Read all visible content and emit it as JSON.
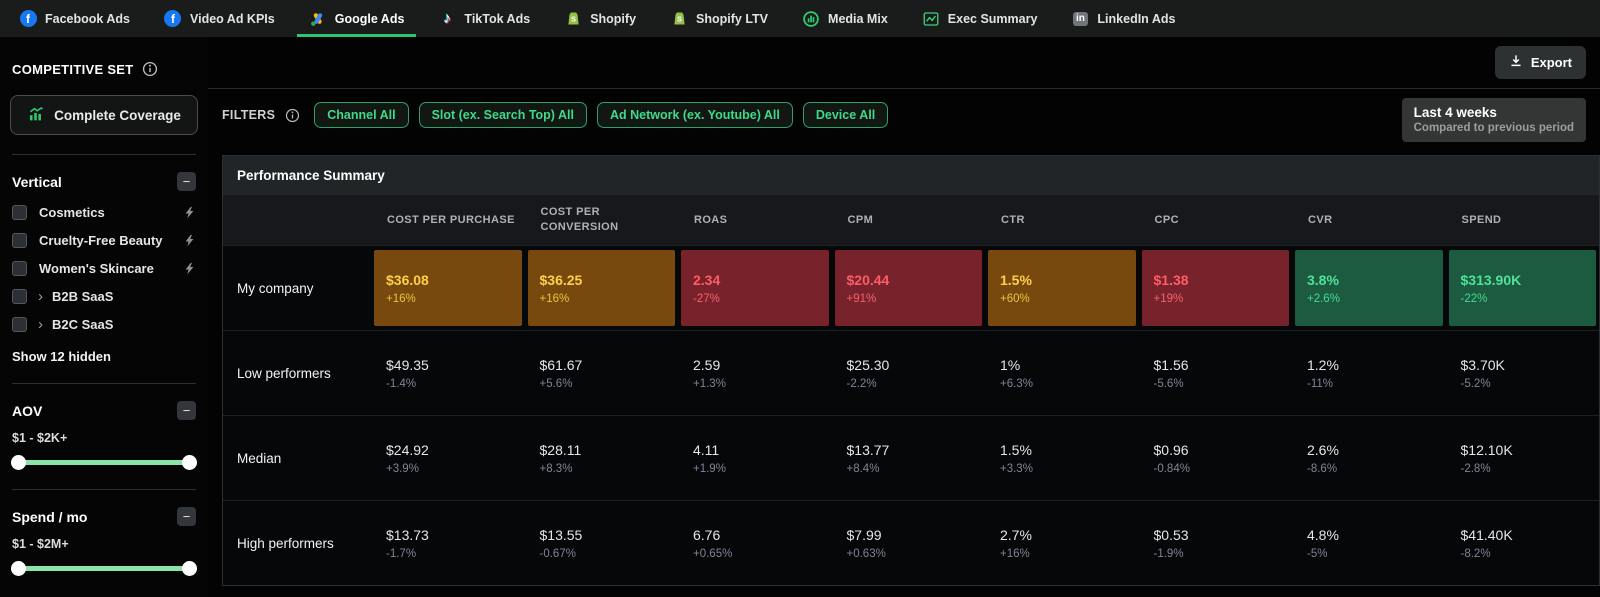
{
  "icons": {
    "facebook_f": "f",
    "music_note": "♪",
    "linkedin_in": "in",
    "chevron_right": "›",
    "minus": "−"
  },
  "colors": {
    "accent_green": "#2ec471",
    "chip_green": "#3fd98a",
    "slider_green": "#8ce3a7",
    "facebook_blue": "#1877f2",
    "warn_bg": "#77490f",
    "warn_text": "#ffd04a",
    "bad_bg": "#78232b",
    "bad_text": "#ff5c68",
    "good_bg": "#1d5b40",
    "good_text": "#4fe29a"
  },
  "nav": {
    "tabs": [
      {
        "label": "Facebook Ads",
        "icon": "facebook-icon",
        "active": false
      },
      {
        "label": "Video Ad KPIs",
        "icon": "facebook-icon",
        "active": false
      },
      {
        "label": "Google Ads",
        "icon": "google-ads-icon",
        "active": true
      },
      {
        "label": "TikTok Ads",
        "icon": "tiktok-icon",
        "active": false
      },
      {
        "label": "Shopify",
        "icon": "shopify-icon",
        "active": false
      },
      {
        "label": "Shopify LTV",
        "icon": "shopify-icon",
        "active": false
      },
      {
        "label": "Media Mix",
        "icon": "media-mix-icon",
        "active": false
      },
      {
        "label": "Exec Summary",
        "icon": "exec-summary-icon",
        "active": false
      },
      {
        "label": "LinkedIn Ads",
        "icon": "linkedin-icon",
        "active": false
      }
    ]
  },
  "sidebar": {
    "title": "COMPETITIVE SET",
    "coverage_button_label": "Complete Coverage",
    "vertical": {
      "title": "Vertical",
      "items": [
        {
          "label": "Cosmetics"
        },
        {
          "label": "Cruelty-Free Beauty"
        },
        {
          "label": "Women's Skincare"
        },
        {
          "label": "B2B SaaS"
        },
        {
          "label": "B2C SaaS"
        }
      ],
      "show_hidden_label": "Show 12 hidden"
    },
    "aov": {
      "title": "AOV",
      "range_label": "$1 - $2K+"
    },
    "spend": {
      "title": "Spend / mo",
      "range_label": "$1 - $2M+"
    }
  },
  "toolbar": {
    "export_label": "Export"
  },
  "filters": {
    "label": "FILTERS",
    "chips": [
      "Channel All",
      "Slot (ex. Search Top) All",
      "Ad Network (ex. Youtube) All",
      "Device All"
    ]
  },
  "period": {
    "title": "Last 4 weeks",
    "subtitle": "Compared to previous period"
  },
  "table": {
    "title": "Performance Summary",
    "columns": [
      "COST PER PURCHASE",
      "COST PER CONVERSION",
      "ROAS",
      "CPM",
      "CTR",
      "CPC",
      "CVR",
      "SPEND"
    ],
    "rows": [
      {
        "label": "My company",
        "cells": [
          {
            "value": "$36.08",
            "delta": "+16%",
            "status": "warn"
          },
          {
            "value": "$36.25",
            "delta": "+16%",
            "status": "warn"
          },
          {
            "value": "2.34",
            "delta": "-27%",
            "status": "bad"
          },
          {
            "value": "$20.44",
            "delta": "+91%",
            "status": "bad"
          },
          {
            "value": "1.5%",
            "delta": "+60%",
            "status": "warn"
          },
          {
            "value": "$1.38",
            "delta": "+19%",
            "status": "bad"
          },
          {
            "value": "3.8%",
            "delta": "+2.6%",
            "status": "good"
          },
          {
            "value": "$313.90K",
            "delta": "-22%",
            "status": "good"
          }
        ]
      },
      {
        "label": "Low performers",
        "cells": [
          {
            "value": "$49.35",
            "delta": "-1.4%"
          },
          {
            "value": "$61.67",
            "delta": "+5.6%"
          },
          {
            "value": "2.59",
            "delta": "+1.3%"
          },
          {
            "value": "$25.30",
            "delta": "-2.2%"
          },
          {
            "value": "1%",
            "delta": "+6.3%"
          },
          {
            "value": "$1.56",
            "delta": "-5.6%"
          },
          {
            "value": "1.2%",
            "delta": "-11%"
          },
          {
            "value": "$3.70K",
            "delta": "-5.2%"
          }
        ]
      },
      {
        "label": "Median",
        "cells": [
          {
            "value": "$24.92",
            "delta": "+3.9%"
          },
          {
            "value": "$28.11",
            "delta": "+8.3%"
          },
          {
            "value": "4.11",
            "delta": "+1.9%"
          },
          {
            "value": "$13.77",
            "delta": "+8.4%"
          },
          {
            "value": "1.5%",
            "delta": "+3.3%"
          },
          {
            "value": "$0.96",
            "delta": "-0.84%"
          },
          {
            "value": "2.6%",
            "delta": "-8.6%"
          },
          {
            "value": "$12.10K",
            "delta": "-2.8%"
          }
        ]
      },
      {
        "label": "High performers",
        "cells": [
          {
            "value": "$13.73",
            "delta": "-1.7%"
          },
          {
            "value": "$13.55",
            "delta": "-0.67%"
          },
          {
            "value": "6.76",
            "delta": "+0.65%"
          },
          {
            "value": "$7.99",
            "delta": "+0.63%"
          },
          {
            "value": "2.7%",
            "delta": "+16%"
          },
          {
            "value": "$0.53",
            "delta": "-1.9%"
          },
          {
            "value": "4.8%",
            "delta": "-5%"
          },
          {
            "value": "$41.40K",
            "delta": "-8.2%"
          }
        ]
      }
    ]
  }
}
